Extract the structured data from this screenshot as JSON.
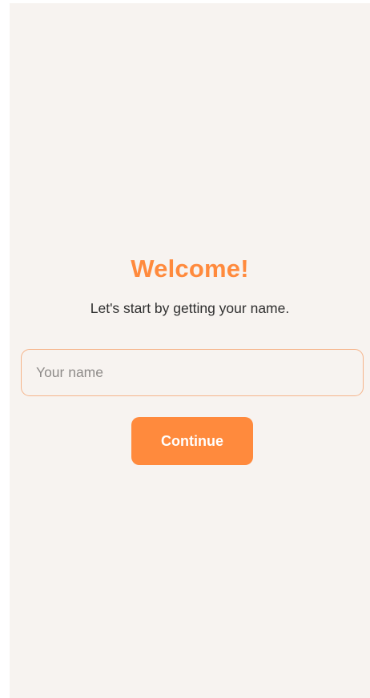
{
  "welcome": {
    "title": "Welcome!",
    "subtitle": "Let's start by getting your name.",
    "name_placeholder": "Your name",
    "name_value": "",
    "continue_label": "Continue"
  },
  "colors": {
    "accent": "#ff8a3d",
    "background": "#f7f3f0",
    "input_border": "#f6b48a",
    "text": "#2f2f2f"
  }
}
